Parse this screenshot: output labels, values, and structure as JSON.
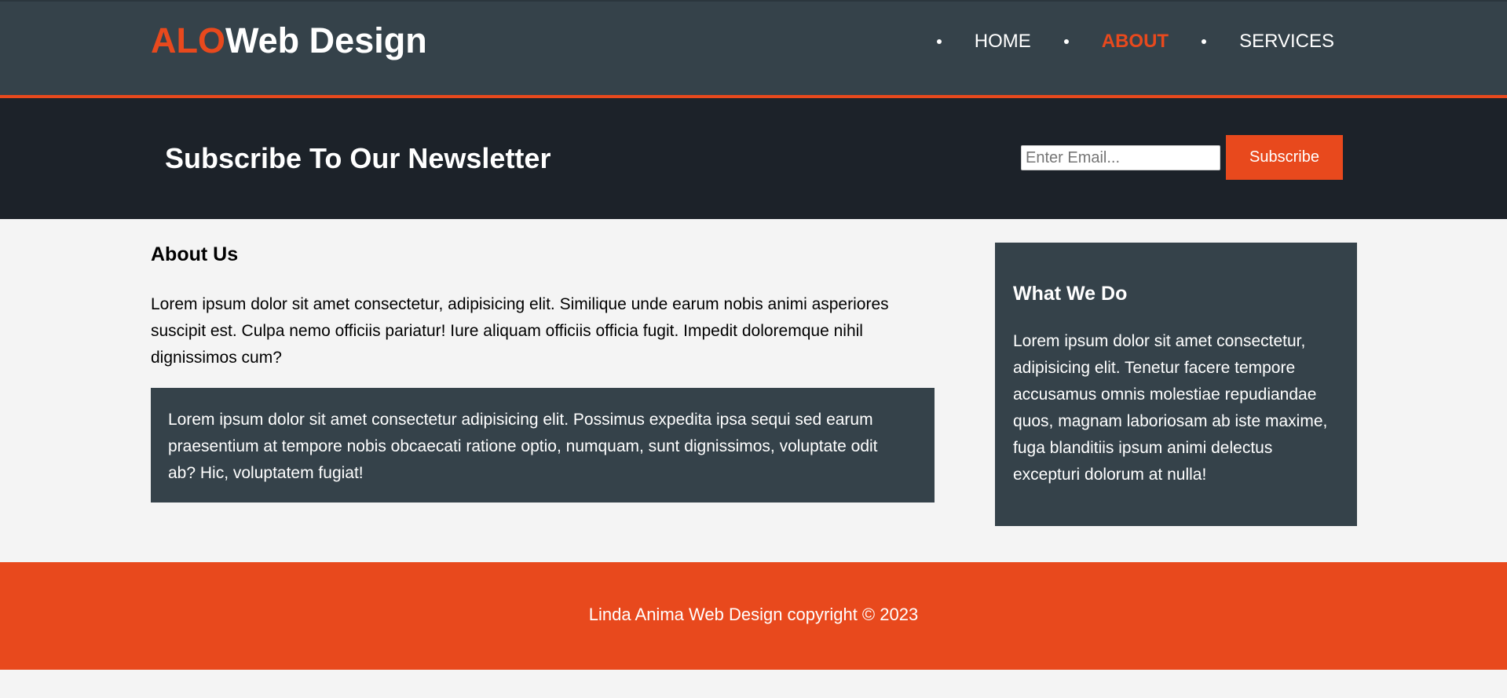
{
  "header": {
    "brand_highlight": "ALO",
    "brand_rest": "Web Design",
    "nav": [
      {
        "label": "HOME"
      },
      {
        "label": "ABOUT"
      },
      {
        "label": "SERVICES"
      }
    ]
  },
  "newsletter": {
    "title": "Subscribe To Our Newsletter",
    "email_placeholder": "Enter Email...",
    "email_value": "",
    "subscribe_label": "Subscribe"
  },
  "main": {
    "heading": "About Us",
    "paragraph": "Lorem ipsum dolor sit amet consectetur, adipisicing elit. Similique unde earum nobis animi asperiores suscipit est. Culpa nemo officiis pariatur! Iure aliquam officiis officia fugit. Impedit doloremque nihil dignissimos cum?",
    "dark_box_text": "Lorem ipsum dolor sit amet consectetur adipisicing elit. Possimus expedita ipsa sequi sed earum praesentium at tempore nobis obcaecati ratione optio, numquam, sunt dignissimos, voluptate odit ab? Hic, voluptatem fugiat!"
  },
  "sidebar": {
    "heading": "What We Do",
    "paragraph": "Lorem ipsum dolor sit amet consectetur, adipisicing elit. Tenetur facere tempore accusamus omnis molestiae repudiandae quos, magnam laboriosam ab iste maxime, fuga blanditiis ipsum animi delectus excepturi dolorum at nulla!"
  },
  "footer": {
    "text": "Linda Anima Web Design copyright © 2023"
  },
  "colors": {
    "accent": "#e8491d",
    "header_bg": "#35424a",
    "newsletter_bg": "#1c2229",
    "page_bg": "#f4f4f4"
  }
}
